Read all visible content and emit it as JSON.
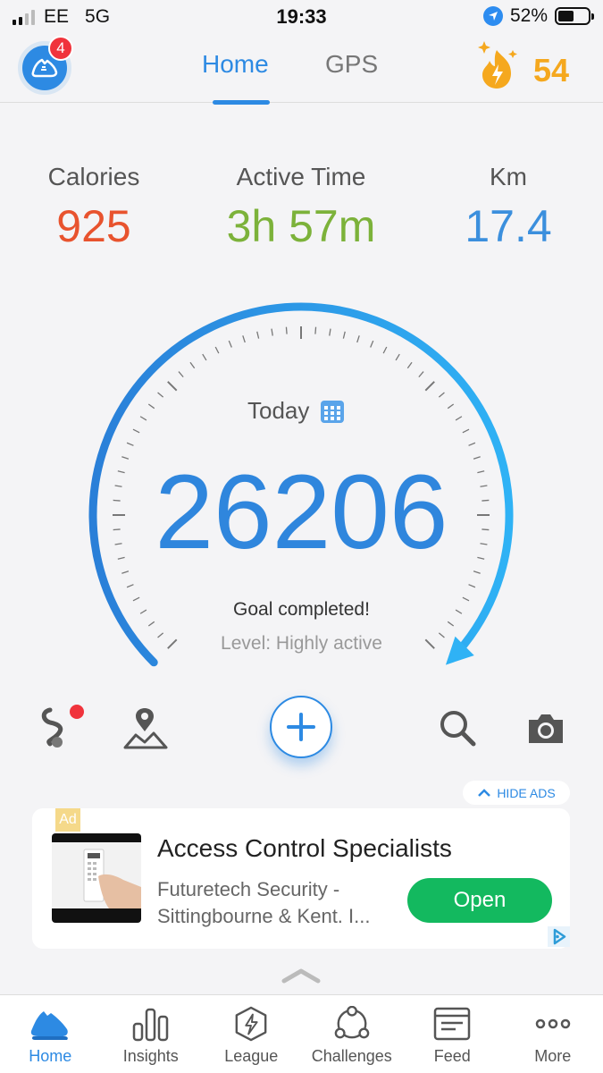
{
  "status_bar": {
    "carrier": "EE",
    "network": "5G",
    "time": "19:33",
    "battery": "52%",
    "battery_level": 0.52
  },
  "header": {
    "notification_count": "4",
    "tabs": [
      {
        "label": "Home",
        "active": true
      },
      {
        "label": "GPS",
        "active": false
      }
    ],
    "points": "54"
  },
  "stats": [
    {
      "label": "Calories",
      "value": "925",
      "color": "#e8532e"
    },
    {
      "label": "Active Time",
      "value": "3h 57m",
      "color": "#7cb23a"
    },
    {
      "label": "Km",
      "value": "17.4",
      "color": "#3b8fdd"
    }
  ],
  "dial": {
    "label": "Today",
    "steps": "26206",
    "goal_text": "Goal completed!",
    "level_text": "Level: Highly active",
    "progress": 1.0
  },
  "ad": {
    "hide_label": "HIDE ADS",
    "ad_tag": "Ad",
    "title": "Access Control Specialists",
    "subtitle": "Futuretech Security - Sittingbourne & Kent. I...",
    "cta": "Open"
  },
  "bottom_nav": [
    {
      "label": "Home",
      "icon": "shoe-icon",
      "active": true
    },
    {
      "label": "Insights",
      "icon": "bar-chart-icon",
      "active": false
    },
    {
      "label": "League",
      "icon": "league-hexagon-icon",
      "active": false
    },
    {
      "label": "Challenges",
      "icon": "challenges-icon",
      "active": false
    },
    {
      "label": "Feed",
      "icon": "feed-icon",
      "active": false
    },
    {
      "label": "More",
      "icon": "more-dots-icon",
      "active": false
    }
  ],
  "colors": {
    "accent": "#2d8ae3",
    "points": "#f5a81e",
    "cta": "#13b95f"
  }
}
